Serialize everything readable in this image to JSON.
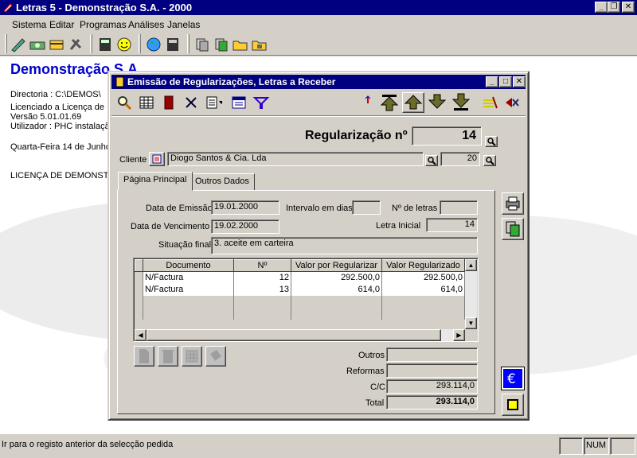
{
  "app": {
    "title": "Letras 5 - Demonstração S.A. - 2000",
    "menu": [
      "Sistema",
      "Editar",
      "Programas",
      "Análises",
      "Janelas"
    ]
  },
  "desktop": {
    "heading": "Demonstração S.A.",
    "lines": [
      "Directoria : C:\\DEMOS\\",
      "Licenciado a Licença de",
      "Versão 5.01.01.69",
      "Utilizador : PHC instalação",
      "Quarta-Feira 14 de Junho",
      "LICENÇA DE DEMONSTRA"
    ]
  },
  "dialog": {
    "title": "Emissão de Regularizações, Letras a Receber",
    "reg_label": "Regularização nº",
    "reg_number": "14",
    "cliente_label": "Cliente",
    "cliente_name": "Diogo Santos & Cia. Lda",
    "cliente_number": "20",
    "tabs": [
      "Página Principal",
      "Outros Dados"
    ],
    "data_emissao_label": "Data de Emissão",
    "data_emissao": "19.01.2000",
    "intervalo_label": "Intervalo em dias",
    "intervalo_value": "",
    "num_letras_label": "Nº de letras",
    "num_letras_value": "",
    "data_vencimento_label": "Data de Vencimento",
    "data_vencimento": "19.02.2000",
    "letra_inicial_label": "Letra Inicial",
    "letra_inicial": "14",
    "situacao_label": "Situação final",
    "situacao_value": "3. aceite em carteira",
    "grid": {
      "columns": [
        "Documento",
        "Nº",
        "Valor por Regularizar",
        "Valor Regularizado"
      ],
      "rows": [
        [
          "N/Factura",
          "12",
          "292.500,0",
          "292.500,0"
        ],
        [
          "N/Factura",
          "13",
          "614,0",
          "614,0"
        ]
      ]
    },
    "totals": {
      "outros_label": "Outros",
      "outros_value": "",
      "reformas_label": "Reformas",
      "reformas_value": "",
      "cc_label": "C/C",
      "cc_value": "293.114,0",
      "total_label": "Total",
      "total_value": "293.114,0"
    }
  },
  "status": {
    "message": "Ir para o registo anterior da selecção pedida",
    "num": "NUM"
  },
  "colors": {
    "title_bar": "#000080",
    "heading_blue": "#0000cc",
    "euro_button": "#0000ff",
    "yellow_square": "#ffff00"
  }
}
